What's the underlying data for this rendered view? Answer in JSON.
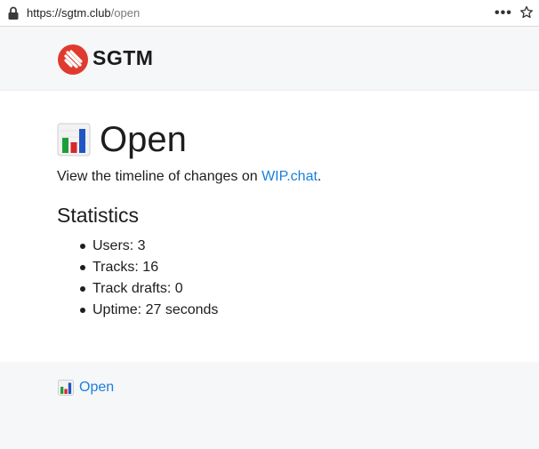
{
  "browser": {
    "url_host": "https://sgtm.club",
    "url_path": "/open",
    "more_label": "•••"
  },
  "header": {
    "brand": "SGTM",
    "brand_color": "#e03a2f"
  },
  "main": {
    "title_icon": "bar-chart-icon",
    "title": "Open",
    "intro_prefix": "View the timeline of changes on ",
    "intro_link": "WIP.chat",
    "intro_suffix": ".",
    "stats_heading": "Statistics",
    "stats": [
      "Users: 3",
      "Tracks: 16",
      "Track drafts: 0",
      "Uptime: 27 seconds"
    ]
  },
  "footer": {
    "link_icon": "bar-chart-icon",
    "link_label": "Open"
  },
  "colors": {
    "link": "#1a7fdb",
    "header_bg": "#f6f7f9"
  }
}
